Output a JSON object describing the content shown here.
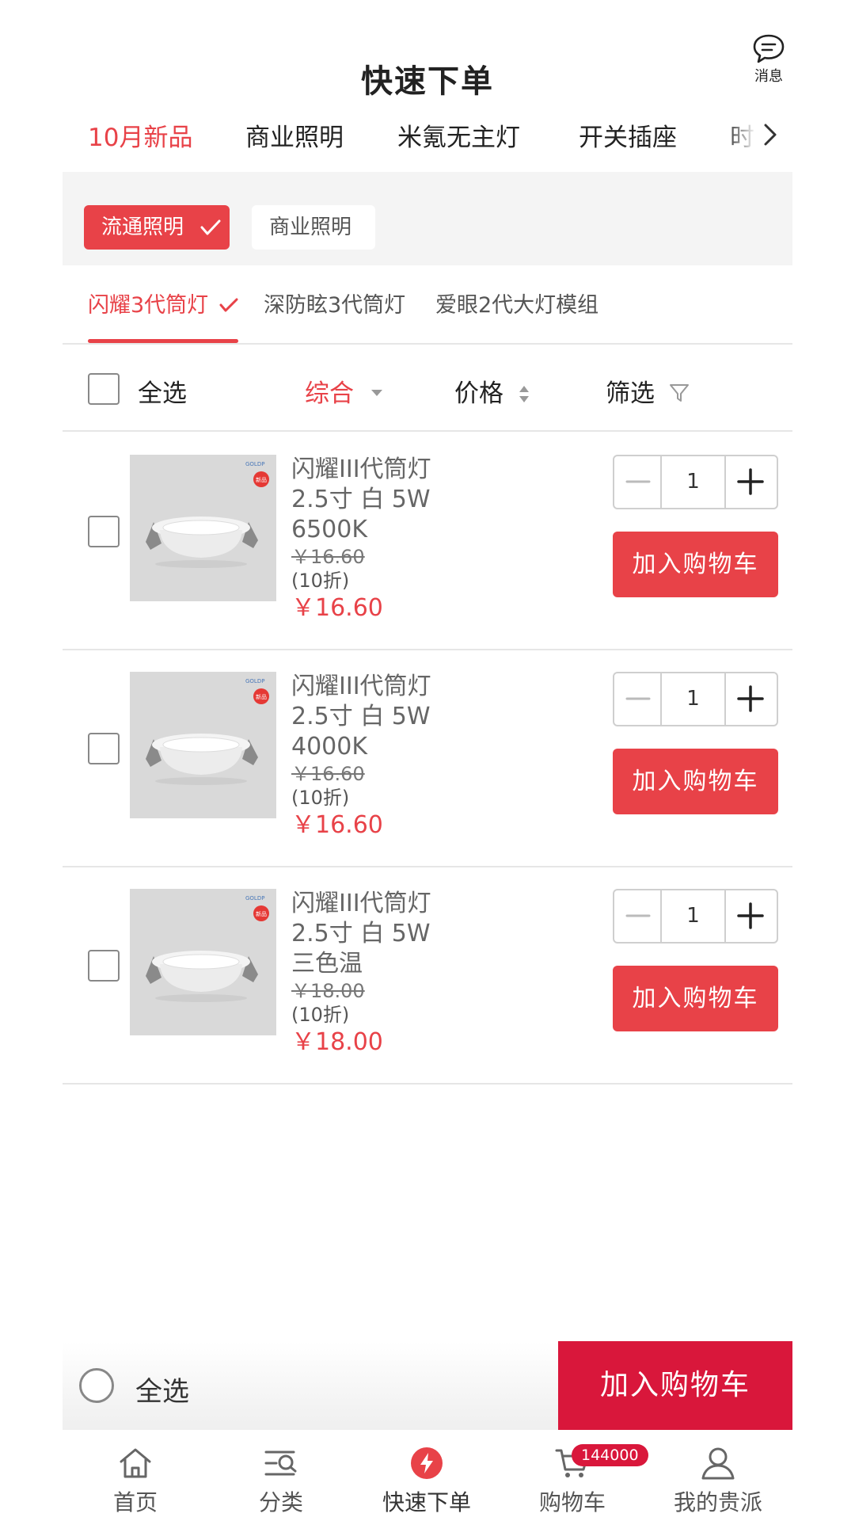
{
  "header": {
    "title": "快速下单",
    "message_label": "消息"
  },
  "category_tabs": [
    {
      "label": "10月新品",
      "active": true
    },
    {
      "label": "商业照明",
      "active": false
    },
    {
      "label": "米氪无主灯",
      "active": false
    },
    {
      "label": "开关插座",
      "active": false
    },
    {
      "label": "时",
      "active": false
    }
  ],
  "sub_categories": [
    {
      "label": "流通照明",
      "active": true
    },
    {
      "label": "商业照明",
      "active": false
    }
  ],
  "series_tabs": [
    {
      "label": "闪耀3代筒灯",
      "active": true
    },
    {
      "label": "深防眩3代筒灯",
      "active": false
    },
    {
      "label": "爱眼2代大灯模组",
      "active": false
    }
  ],
  "sort_bar": {
    "select_all": "全选",
    "sort_comprehensive": "综合",
    "sort_price": "价格",
    "filter": "筛选"
  },
  "products": [
    {
      "name_line1": "闪耀III代筒灯",
      "name_line2": "2.5寸 白 5W",
      "name_line3": "6500K",
      "original_price": "￥16.60",
      "discount": "(10折)",
      "price": "￥16.60",
      "quantity": "1",
      "add_label": "加入购物车"
    },
    {
      "name_line1": "闪耀III代筒灯",
      "name_line2": "2.5寸 白 5W",
      "name_line3": "4000K",
      "original_price": "￥16.60",
      "discount": "(10折)",
      "price": "￥16.60",
      "quantity": "1",
      "add_label": "加入购物车"
    },
    {
      "name_line1": "闪耀III代筒灯",
      "name_line2": "2.5寸 白 5W",
      "name_line3": "三色温",
      "original_price": "￥18.00",
      "discount": "(10折)",
      "price": "￥18.00",
      "quantity": "1",
      "add_label": "加入购物车"
    }
  ],
  "thumb_logo": {
    "brand": "GOLDP",
    "tag": "新品"
  },
  "action_bar": {
    "select_all": "全选",
    "add_to_cart": "加入购物车"
  },
  "bottom_nav": [
    {
      "label": "首页",
      "icon": "home-icon"
    },
    {
      "label": "分类",
      "icon": "category-icon"
    },
    {
      "label": "快速下单",
      "icon": "lightning-icon",
      "active": true
    },
    {
      "label": "购物车",
      "icon": "cart-icon",
      "badge": "144000"
    },
    {
      "label": "我的贵派",
      "icon": "user-icon"
    }
  ],
  "colors": {
    "accent": "#e84248",
    "cart_button": "#d9173b",
    "divider": "#e6e6e6",
    "band": "#f4f4f4"
  }
}
